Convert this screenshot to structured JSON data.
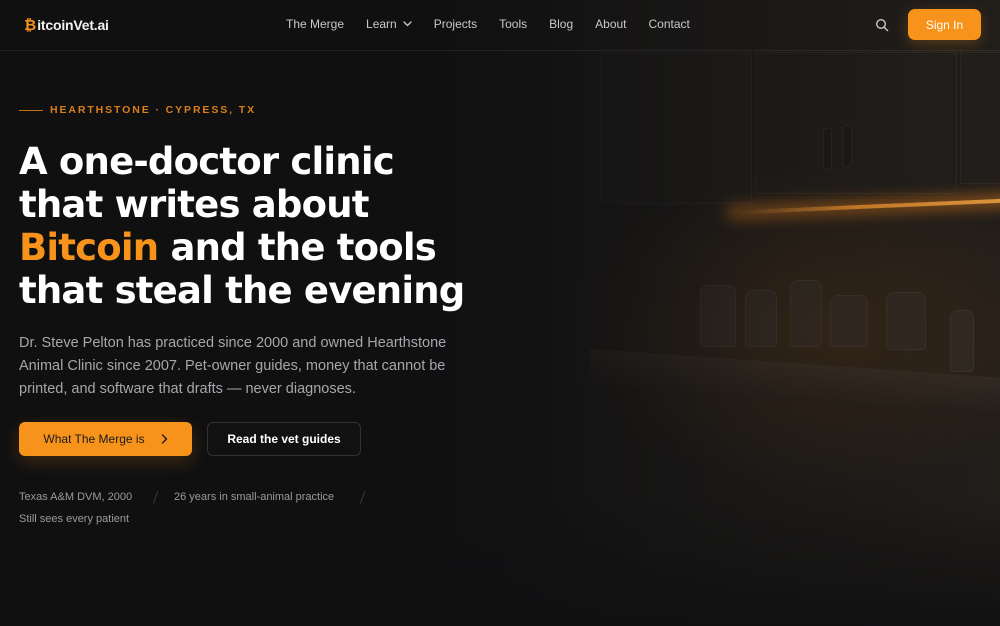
{
  "logo": {
    "btc_glyph": "₿",
    "text": "itcoinVet.ai"
  },
  "nav": {
    "items": [
      {
        "label": "The Merge"
      },
      {
        "label": "Learn",
        "has_dropdown": true
      },
      {
        "label": "Projects"
      },
      {
        "label": "Tools"
      },
      {
        "label": "Blog"
      },
      {
        "label": "About"
      },
      {
        "label": "Contact"
      }
    ],
    "search_icon": "search-icon",
    "signin_label": "Sign In"
  },
  "hero": {
    "eyebrow": "HEARTHSTONE · CYPRESS, TX",
    "headline": {
      "line1": "A one-doctor clinic",
      "line2": "that writes about",
      "accent": "Bitcoin",
      "line3_rest": " and the tools",
      "line4": "that steal the evening"
    },
    "lede": "Dr. Steve Pelton has practiced since 2000 and owned Hearthstone Animal Clinic since 2007. Pet-owner guides, money that cannot be printed, and software that drafts — never diagnoses.",
    "primary_button": {
      "label": "What The Merge is",
      "icon": "chevron-right-icon"
    },
    "secondary_button": {
      "label": "Read the vet guides"
    },
    "credentials": [
      "Texas A&M DVM, 2000",
      "26 years in small-animal practice",
      "Still sees every patient"
    ]
  },
  "colors": {
    "accent": "#f7931a",
    "background": "#111112"
  }
}
